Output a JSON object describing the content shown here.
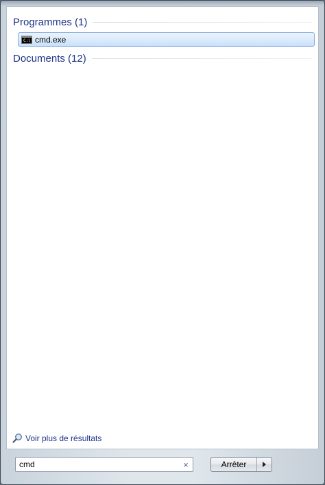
{
  "results": {
    "groups": [
      {
        "title": "Programmes (1)",
        "items": [
          {
            "label": "cmd.exe",
            "icon": "cmd-prompt-icon"
          }
        ]
      },
      {
        "title": "Documents (12)",
        "items": []
      }
    ],
    "see_more_label": "Voir plus de résultats",
    "see_more_icon": "magnifier-icon"
  },
  "search": {
    "value": "cmd",
    "clear_glyph": "×"
  },
  "power": {
    "button_label": "Arrêter",
    "arrow_icon": "arrow-right-icon"
  },
  "colors": {
    "header_text": "#1e3287",
    "selection_border": "#84acdd",
    "selection_fill": "#dcebfc"
  }
}
